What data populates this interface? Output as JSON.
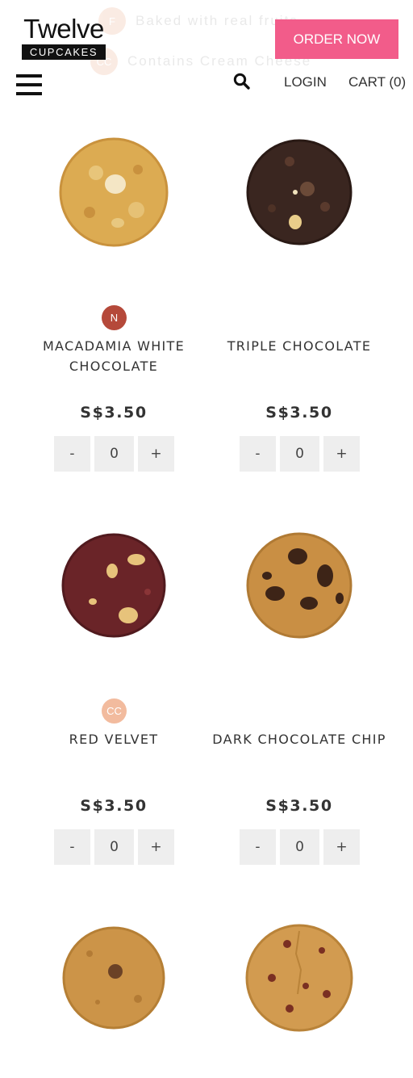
{
  "legend": [
    {
      "badge": "F",
      "text": "Baked with real fruits"
    },
    {
      "badge": "CC",
      "text": "Contains Cream Cheese"
    }
  ],
  "header": {
    "logo_top": "Twelve",
    "logo_bottom": "CUPCAKES",
    "order_label": "ORDER NOW",
    "login_label": "LOGIN",
    "cart_label": "CART (0)"
  },
  "colors": {
    "accent": "#f25c8a",
    "badge_n": "#b5493a",
    "badge_cc": "#f2bb9e"
  },
  "products": [
    {
      "name": "MACADAMIA WHITE CHOCOLATE",
      "price": "S$3.50",
      "qty": "0",
      "minus": "-",
      "plus": "+",
      "badge": "N"
    },
    {
      "name": "TRIPLE CHOCOLATE",
      "price": "S$3.50",
      "qty": "0",
      "minus": "-",
      "plus": "+"
    },
    {
      "name": "RED VELVET",
      "price": "S$3.50",
      "qty": "0",
      "minus": "-",
      "plus": "+",
      "badge": "CC"
    },
    {
      "name": "DARK CHOCOLATE CHIP",
      "price": "S$3.50",
      "qty": "0",
      "minus": "-",
      "plus": "+"
    },
    {
      "name": "",
      "price": "",
      "qty": "",
      "minus": "",
      "plus": ""
    },
    {
      "name": "",
      "price": "",
      "qty": "",
      "minus": "",
      "plus": ""
    }
  ]
}
